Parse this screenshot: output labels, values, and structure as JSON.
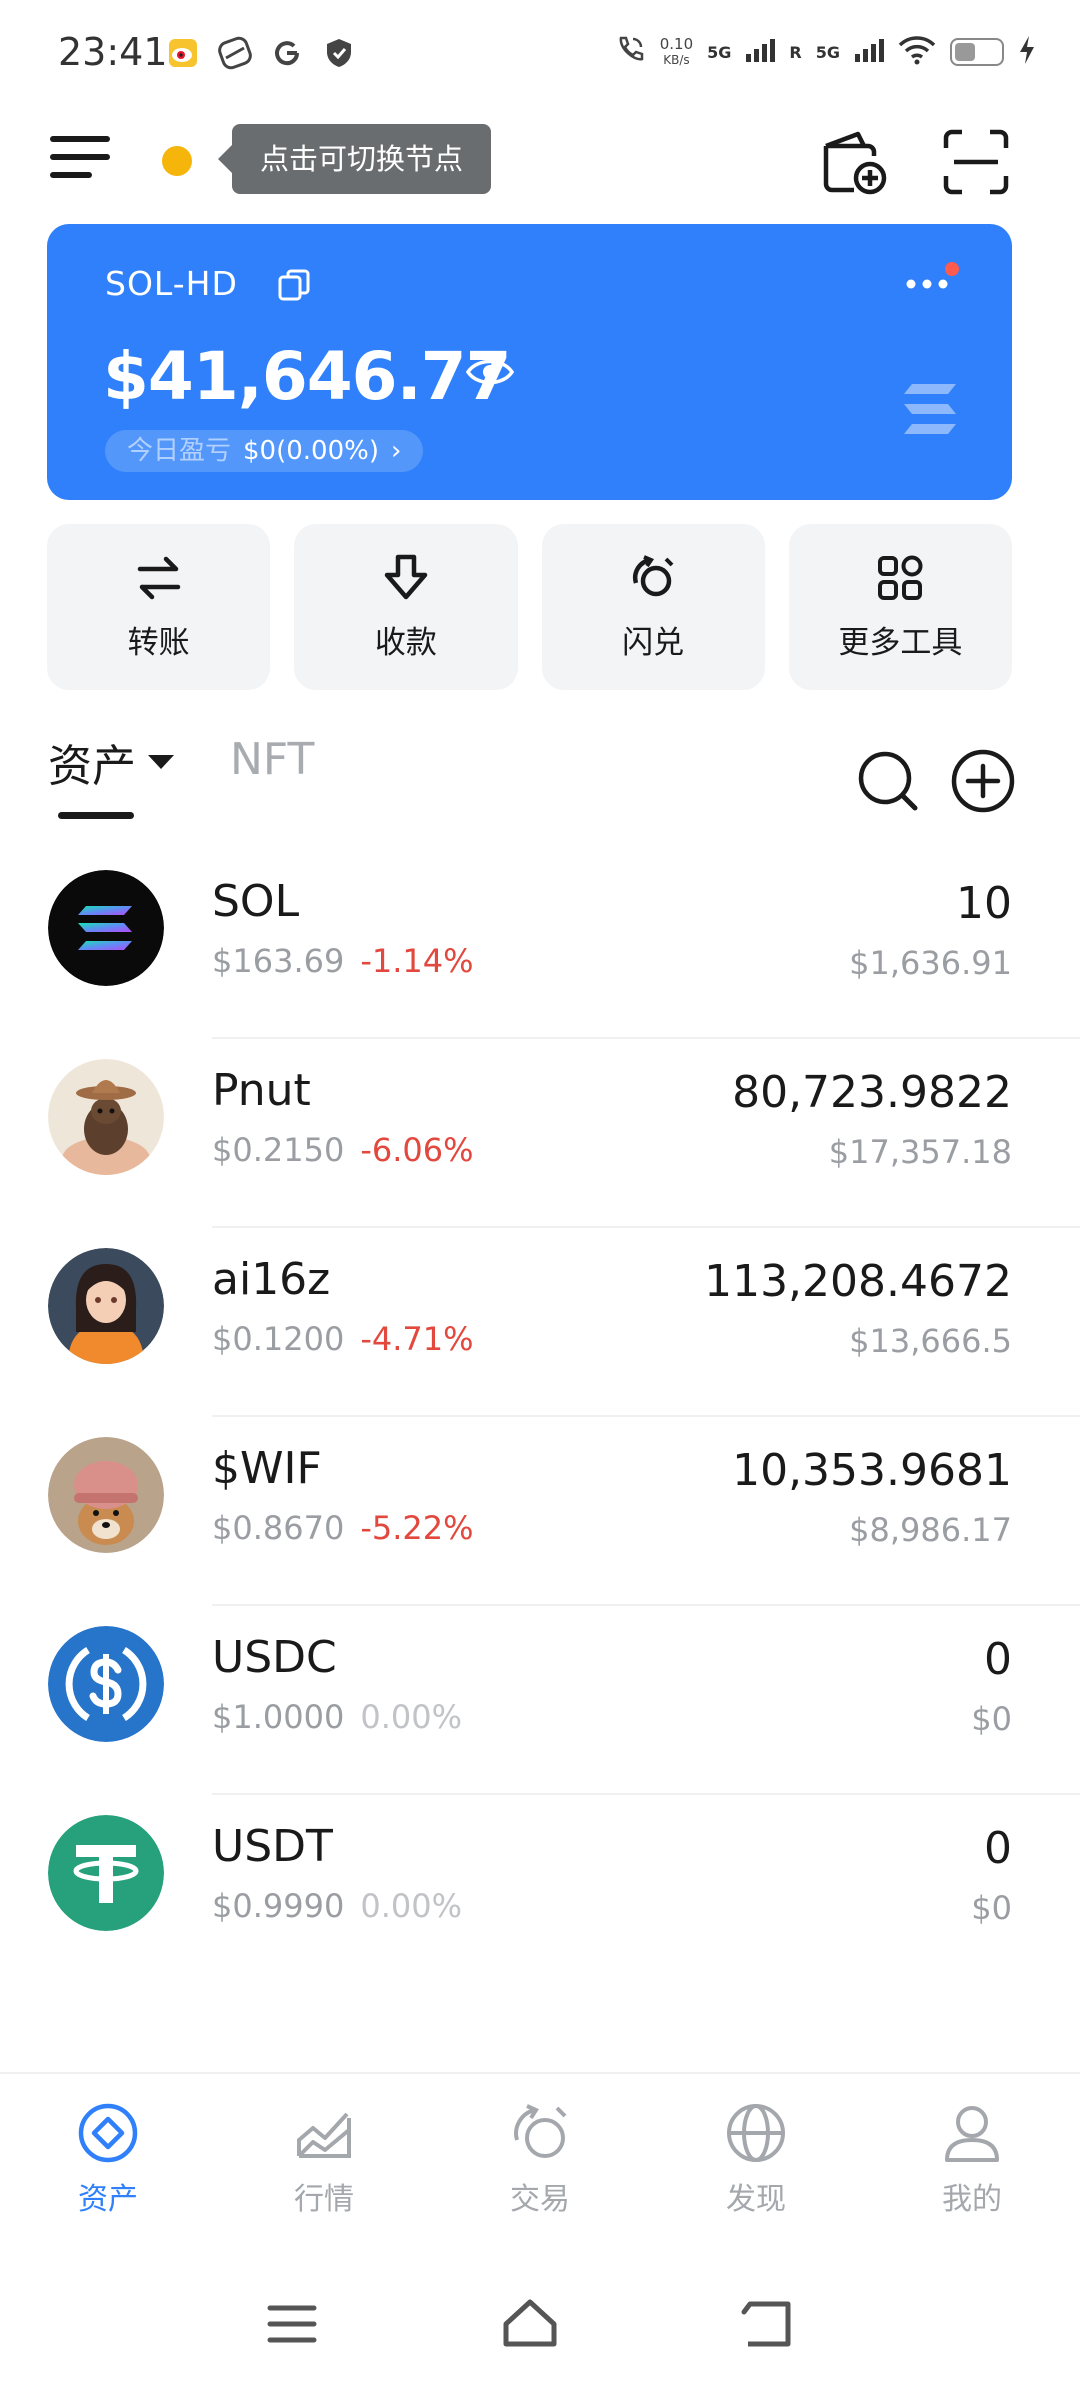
{
  "status_bar": {
    "time": "23:41",
    "net_speed_value": "0.10",
    "net_speed_unit": "KB/s",
    "sim1": "5G",
    "sim2": "5G",
    "roaming": "R",
    "battery_level": 0.45,
    "icons": [
      "weibo-icon",
      "swirl-app-icon",
      "google-icon",
      "shield-icon",
      "wifi-call-icon",
      "signal-icon",
      "wifi-icon",
      "battery-icon",
      "charging-icon"
    ]
  },
  "header": {
    "node_tip": "点击可切换节点",
    "node_status_color": "#f5b50a",
    "icons": [
      "menu-icon",
      "wallet-add-icon",
      "scan-icon"
    ]
  },
  "wallet": {
    "name": "SOL-HD",
    "balance": "$41,646.77",
    "pnl_label": "今日盈亏",
    "pnl_value": "$0(0.00%)",
    "pnl_chevron": "›",
    "card_color": "#2f80fa"
  },
  "actions": [
    {
      "label": "转账",
      "icon": "transfer-icon"
    },
    {
      "label": "收款",
      "icon": "receive-icon"
    },
    {
      "label": "闪兑",
      "icon": "swap-icon"
    },
    {
      "label": "更多工具",
      "icon": "tools-grid-icon"
    }
  ],
  "tabs": {
    "assets": "资产",
    "nft": "NFT"
  },
  "tokens": [
    {
      "symbol": "SOL",
      "price": "$163.69",
      "change": "-1.14%",
      "amount": "10",
      "value": "$1,636.91",
      "logo": "solana-logo"
    },
    {
      "symbol": "Pnut",
      "price": "$0.2150",
      "change": "-6.06%",
      "amount": "80,723.9822",
      "value": "$17,357.18",
      "logo": "pnut-squirrel-logo"
    },
    {
      "symbol": "ai16z",
      "price": "$0.1200",
      "change": "-4.71%",
      "amount": "113,208.4672",
      "value": "$13,666.5",
      "logo": "ai16z-avatar-logo"
    },
    {
      "symbol": "$WIF",
      "price": "$0.8670",
      "change": "-5.22%",
      "amount": "10,353.9681",
      "value": "$8,986.17",
      "logo": "wif-dog-logo"
    },
    {
      "symbol": "USDC",
      "price": "$1.0000",
      "change": "0.00%",
      "amount": "0",
      "value": "$0",
      "logo": "usdc-logo"
    },
    {
      "symbol": "USDT",
      "price": "$0.9990",
      "change": "0.00%",
      "amount": "0",
      "value": "$0",
      "logo": "usdt-logo"
    }
  ],
  "bottom_nav": [
    {
      "label": "资产",
      "icon": "assets-icon",
      "active": true
    },
    {
      "label": "行情",
      "icon": "market-chart-icon",
      "active": false
    },
    {
      "label": "交易",
      "icon": "trade-icon",
      "active": false
    },
    {
      "label": "发现",
      "icon": "globe-icon",
      "active": false
    },
    {
      "label": "我的",
      "icon": "profile-icon",
      "active": false
    }
  ],
  "colors": {
    "accent": "#2f80fa",
    "negative": "#e2483d",
    "muted": "#9a9da2"
  }
}
